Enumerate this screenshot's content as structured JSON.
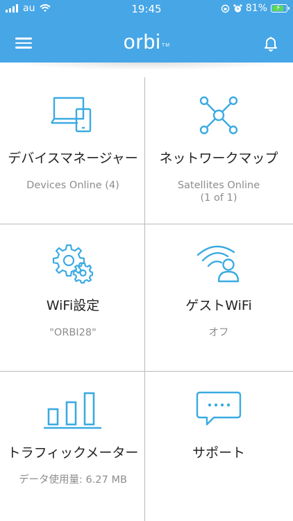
{
  "status_bar": {
    "carrier": "au",
    "time": "19:45",
    "battery": "81%",
    "battery_level": 0.81
  },
  "header": {
    "logo": "orbi",
    "logo_tm": "TM"
  },
  "tiles": [
    {
      "title": "デバイスマネージャー",
      "subtitle": "Devices Online (4)",
      "icon": "devices-icon"
    },
    {
      "title": "ネットワークマップ",
      "subtitle_line1": "Satellites Online",
      "subtitle_line2": "(1 of 1)",
      "icon": "network-map-icon"
    },
    {
      "title": "WiFi設定",
      "subtitle": "\"ORBI28\"",
      "icon": "gears-icon"
    },
    {
      "title": "ゲストWiFi",
      "subtitle": "オフ",
      "icon": "guest-wifi-icon"
    },
    {
      "title": "トラフィックメーター",
      "subtitle": "データ使用量: 6.27 MB",
      "icon": "bar-chart-icon"
    },
    {
      "title": "サポート",
      "subtitle": "",
      "icon": "chat-bubble-icon"
    }
  ],
  "colors": {
    "header_bg": "#47a6e6",
    "icon_blue": "#3aaae2",
    "title_text": "#222222",
    "subtitle_text": "#8c8c8c",
    "divider": "#b9b9b9"
  }
}
